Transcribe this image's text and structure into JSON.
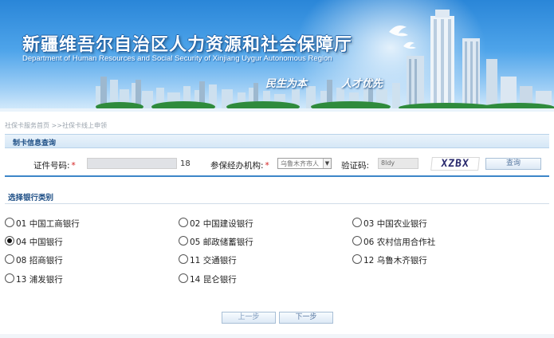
{
  "banner": {
    "title_cn": "新疆维吾尔自治区人力资源和社会保障厅",
    "title_en": "Department of Human Resources and Social Security of Xinjiang Uygur Autonomous Region",
    "slogan_1": "民生为本",
    "slogan_2": "人才优先"
  },
  "breadcrumb": "社保卡服务首页 >>社保卡线上申领",
  "query": {
    "section_title": "制卡信息查询",
    "id_label": "证件号码:",
    "id_value": "",
    "id_suffix": "18",
    "agency_label": "参保经办机构:",
    "agency_value": "乌鲁木齐市人",
    "captcha_label": "验证码:",
    "captcha_value": "8ldy",
    "captcha_image_text": "XZBX",
    "query_button": "查询",
    "required_mark": "*"
  },
  "bank_section": {
    "title": "选择银行类别",
    "banks": [
      {
        "code": "01",
        "name": "中国工商银行",
        "checked": false
      },
      {
        "code": "02",
        "name": "中国建设银行",
        "checked": false
      },
      {
        "code": "03",
        "name": "中国农业银行",
        "checked": false
      },
      {
        "code": "04",
        "name": "中国银行",
        "checked": true
      },
      {
        "code": "05",
        "name": "邮政储蓄银行",
        "checked": false
      },
      {
        "code": "06",
        "name": "农村信用合作社",
        "checked": false
      },
      {
        "code": "08",
        "name": "招商银行",
        "checked": false
      },
      {
        "code": "11",
        "name": "交通银行",
        "checked": false
      },
      {
        "code": "12",
        "name": "乌鲁木齐银行",
        "checked": false
      },
      {
        "code": "13",
        "name": "浦发银行",
        "checked": false
      },
      {
        "code": "14",
        "name": "昆仑银行",
        "checked": false
      }
    ]
  },
  "footer": {
    "prev_button": "上一步",
    "next_button": "下一步"
  }
}
